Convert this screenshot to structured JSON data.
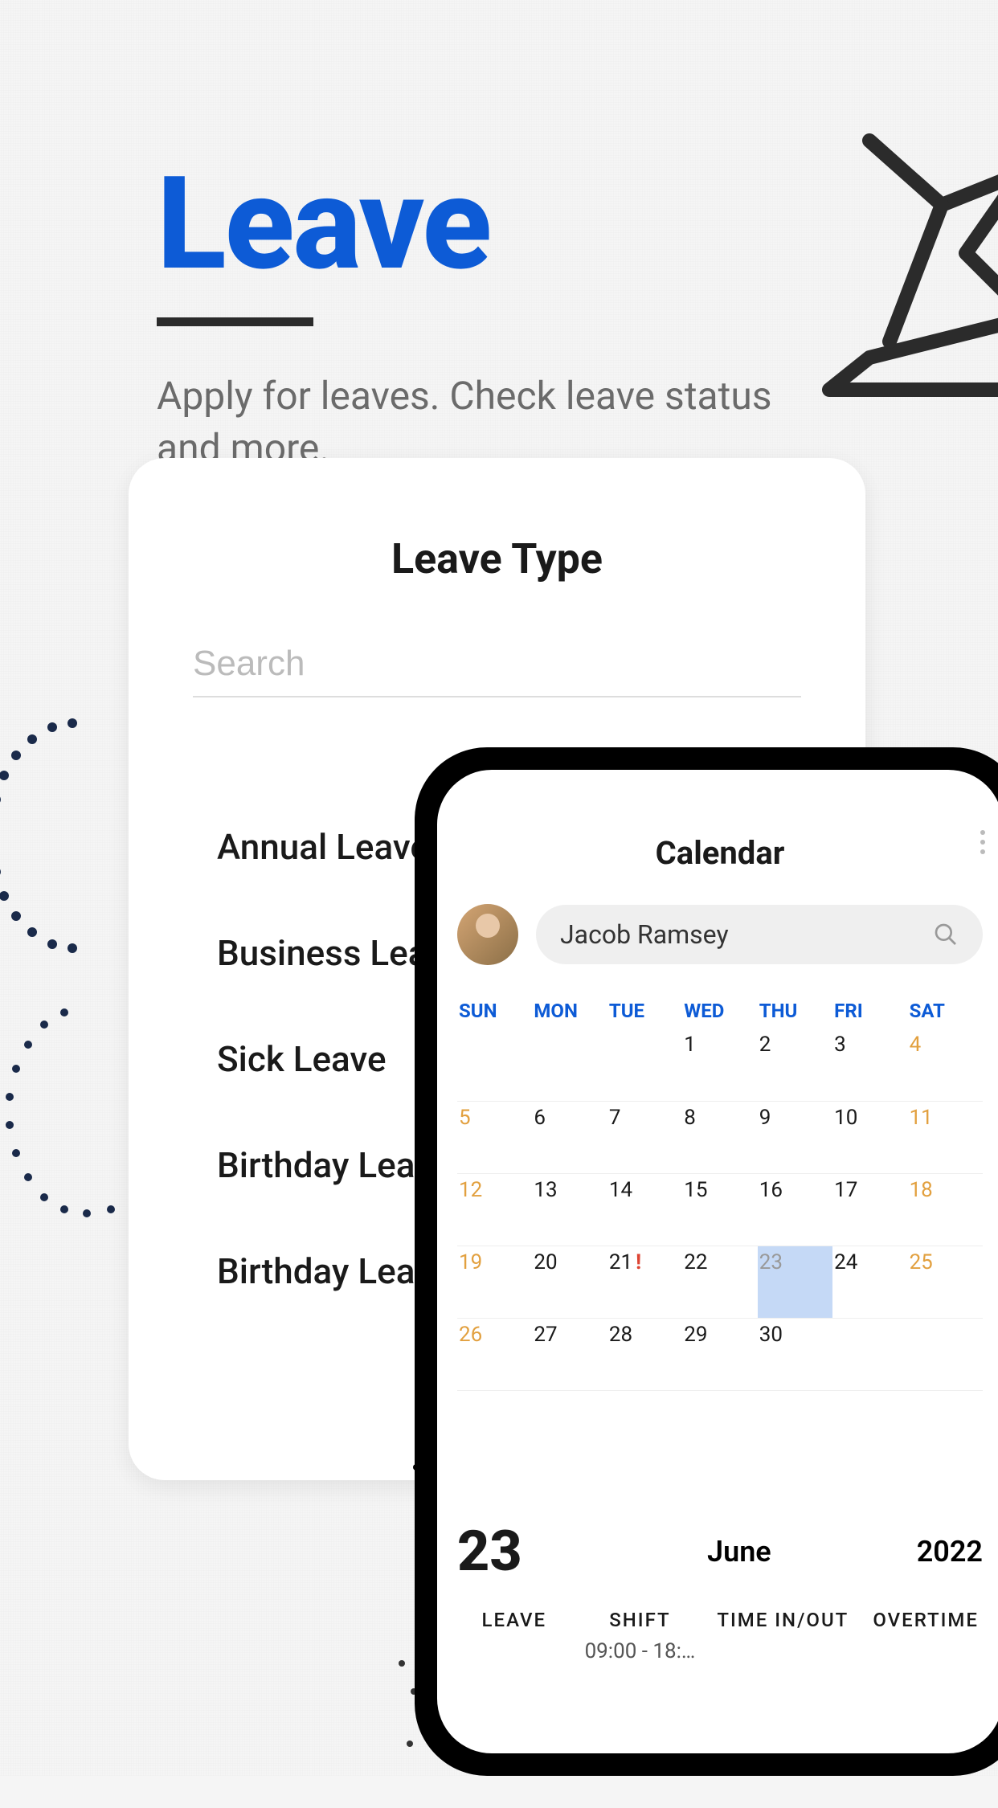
{
  "header": {
    "title": "Leave",
    "subtitle": "Apply for leaves. Check leave status and more."
  },
  "leave_card": {
    "title": "Leave Type",
    "search_placeholder": "Search",
    "items": [
      {
        "label": "Annual Leave"
      },
      {
        "label": "Business Leave"
      },
      {
        "label": "Sick Leave"
      },
      {
        "label": "Birthday Leave"
      },
      {
        "label": "Birthday Leave"
      }
    ]
  },
  "phone": {
    "title": "Calendar",
    "profile_name": "Jacob Ramsey",
    "weekdays": [
      "SUN",
      "MON",
      "TUE",
      "WED",
      "THU",
      "FRI",
      "SAT"
    ],
    "selected_day": "23",
    "month": "June",
    "year": "2022",
    "details": {
      "leave_label": "LEAVE",
      "shift_label": "SHIFT",
      "shift_value": "09:00 - 18:…",
      "timeinout_label": "TIME IN/OUT",
      "overtime_label": "OVERTIME"
    }
  }
}
